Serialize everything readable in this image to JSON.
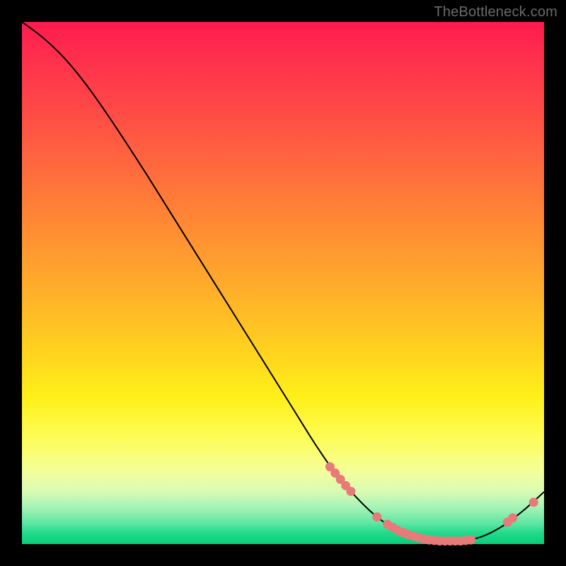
{
  "watermark": "TheBottleneck.com",
  "colors": {
    "curve_stroke": "#000000",
    "marker_fill": "#e77b79",
    "marker_stroke": "#e77b79"
  },
  "chart_data": {
    "type": "line",
    "title": "",
    "xlabel": "",
    "ylabel": "",
    "xlim": [
      0,
      100
    ],
    "ylim": [
      0,
      100
    ],
    "grid": false,
    "legend": false,
    "series": [
      {
        "name": "bottleneck-curve",
        "x": [
          0,
          4,
          8,
          12,
          16,
          20,
          24,
          28,
          32,
          36,
          40,
          44,
          48,
          52,
          56,
          60,
          64,
          68,
          72,
          76,
          80,
          84,
          88,
          92,
          96,
          100
        ],
        "y": [
          100,
          97,
          93.2,
          88.4,
          82.8,
          76.8,
          70.6,
          64.2,
          57.8,
          51.4,
          45.0,
          38.6,
          32.2,
          25.8,
          19.4,
          13.6,
          9.0,
          5.2,
          2.6,
          1.2,
          0.6,
          0.6,
          1.4,
          3.4,
          6.4,
          10.0
        ]
      }
    ],
    "markers": [
      {
        "x": 59,
        "y": 14.8
      },
      {
        "x": 60,
        "y": 13.6
      },
      {
        "x": 61,
        "y": 12.4
      },
      {
        "x": 62,
        "y": 11.2
      },
      {
        "x": 63,
        "y": 10.1
      },
      {
        "x": 68,
        "y": 5.2
      },
      {
        "x": 70,
        "y": 3.8
      },
      {
        "x": 71,
        "y": 3.2
      },
      {
        "x": 72,
        "y": 2.6
      },
      {
        "x": 73,
        "y": 2.2
      },
      {
        "x": 74,
        "y": 1.8
      },
      {
        "x": 75,
        "y": 1.5
      },
      {
        "x": 76,
        "y": 1.2
      },
      {
        "x": 77,
        "y": 1.0
      },
      {
        "x": 78,
        "y": 0.8
      },
      {
        "x": 79,
        "y": 0.7
      },
      {
        "x": 80,
        "y": 0.6
      },
      {
        "x": 81,
        "y": 0.6
      },
      {
        "x": 82,
        "y": 0.6
      },
      {
        "x": 83,
        "y": 0.6
      },
      {
        "x": 84,
        "y": 0.6
      },
      {
        "x": 85,
        "y": 0.7
      },
      {
        "x": 86,
        "y": 0.8
      },
      {
        "x": 93,
        "y": 4.2
      },
      {
        "x": 94,
        "y": 5.0
      },
      {
        "x": 98,
        "y": 8.0
      }
    ]
  }
}
